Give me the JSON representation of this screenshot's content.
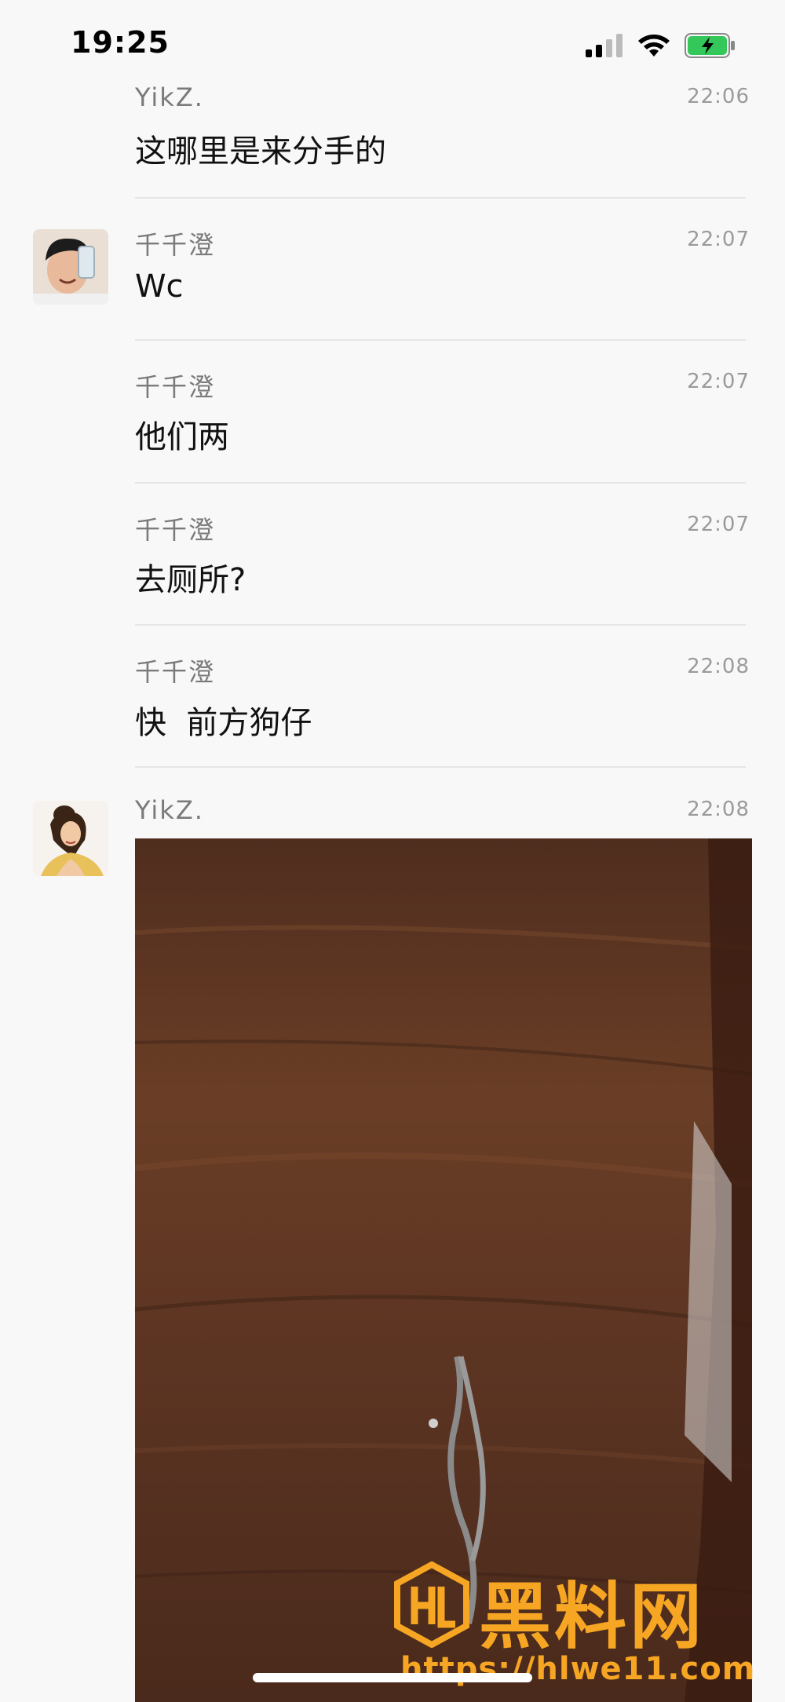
{
  "status_bar": {
    "time": "19:25",
    "signal_icon": "signal-icon",
    "wifi_icon": "wifi-icon",
    "battery_icon": "battery-charging-icon"
  },
  "messages": [
    {
      "sender": "YikZ.",
      "time": "22:06",
      "text": "这哪里是来分手的"
    },
    {
      "sender": "千千澄",
      "time": "22:07",
      "text": "Wc",
      "avatar": "avatar-photo-man"
    },
    {
      "sender": "千千澄",
      "time": "22:07",
      "text": "他们两"
    },
    {
      "sender": "千千澄",
      "time": "22:07",
      "text": "去厕所?"
    },
    {
      "sender": "千千澄",
      "time": "22:08",
      "text": "快  前方狗仔"
    },
    {
      "sender": "YikZ.",
      "time": "22:08",
      "image": "photo-wooden-table-with-cord",
      "avatar": "avatar-cartoon-princess"
    }
  ],
  "watermark": {
    "title": "黑料网",
    "url": "https://hlwe11.com",
    "logo": "hl-logo-icon"
  },
  "colors": {
    "background": "#f8f8f8",
    "watermark": "#f6a623",
    "wood": "#5a3220"
  }
}
